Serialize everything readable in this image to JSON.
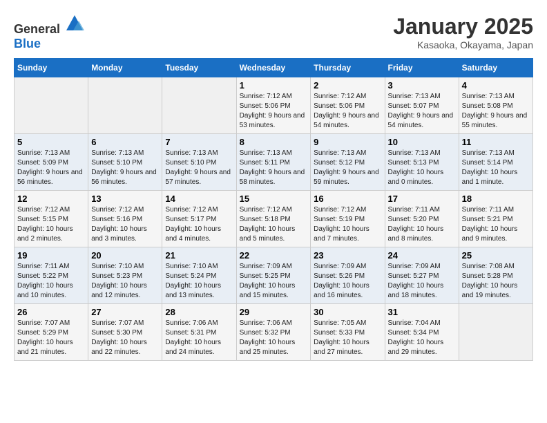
{
  "logo": {
    "general": "General",
    "blue": "Blue"
  },
  "title": "January 2025",
  "subtitle": "Kasaoka, Okayama, Japan",
  "days_of_week": [
    "Sunday",
    "Monday",
    "Tuesday",
    "Wednesday",
    "Thursday",
    "Friday",
    "Saturday"
  ],
  "weeks": [
    [
      {
        "day": "",
        "info": ""
      },
      {
        "day": "",
        "info": ""
      },
      {
        "day": "",
        "info": ""
      },
      {
        "day": "1",
        "info": "Sunrise: 7:12 AM\nSunset: 5:06 PM\nDaylight: 9 hours and 53 minutes."
      },
      {
        "day": "2",
        "info": "Sunrise: 7:12 AM\nSunset: 5:06 PM\nDaylight: 9 hours and 54 minutes."
      },
      {
        "day": "3",
        "info": "Sunrise: 7:13 AM\nSunset: 5:07 PM\nDaylight: 9 hours and 54 minutes."
      },
      {
        "day": "4",
        "info": "Sunrise: 7:13 AM\nSunset: 5:08 PM\nDaylight: 9 hours and 55 minutes."
      }
    ],
    [
      {
        "day": "5",
        "info": "Sunrise: 7:13 AM\nSunset: 5:09 PM\nDaylight: 9 hours and 56 minutes."
      },
      {
        "day": "6",
        "info": "Sunrise: 7:13 AM\nSunset: 5:10 PM\nDaylight: 9 hours and 56 minutes."
      },
      {
        "day": "7",
        "info": "Sunrise: 7:13 AM\nSunset: 5:10 PM\nDaylight: 9 hours and 57 minutes."
      },
      {
        "day": "8",
        "info": "Sunrise: 7:13 AM\nSunset: 5:11 PM\nDaylight: 9 hours and 58 minutes."
      },
      {
        "day": "9",
        "info": "Sunrise: 7:13 AM\nSunset: 5:12 PM\nDaylight: 9 hours and 59 minutes."
      },
      {
        "day": "10",
        "info": "Sunrise: 7:13 AM\nSunset: 5:13 PM\nDaylight: 10 hours and 0 minutes."
      },
      {
        "day": "11",
        "info": "Sunrise: 7:13 AM\nSunset: 5:14 PM\nDaylight: 10 hours and 1 minute."
      }
    ],
    [
      {
        "day": "12",
        "info": "Sunrise: 7:12 AM\nSunset: 5:15 PM\nDaylight: 10 hours and 2 minutes."
      },
      {
        "day": "13",
        "info": "Sunrise: 7:12 AM\nSunset: 5:16 PM\nDaylight: 10 hours and 3 minutes."
      },
      {
        "day": "14",
        "info": "Sunrise: 7:12 AM\nSunset: 5:17 PM\nDaylight: 10 hours and 4 minutes."
      },
      {
        "day": "15",
        "info": "Sunrise: 7:12 AM\nSunset: 5:18 PM\nDaylight: 10 hours and 5 minutes."
      },
      {
        "day": "16",
        "info": "Sunrise: 7:12 AM\nSunset: 5:19 PM\nDaylight: 10 hours and 7 minutes."
      },
      {
        "day": "17",
        "info": "Sunrise: 7:11 AM\nSunset: 5:20 PM\nDaylight: 10 hours and 8 minutes."
      },
      {
        "day": "18",
        "info": "Sunrise: 7:11 AM\nSunset: 5:21 PM\nDaylight: 10 hours and 9 minutes."
      }
    ],
    [
      {
        "day": "19",
        "info": "Sunrise: 7:11 AM\nSunset: 5:22 PM\nDaylight: 10 hours and 10 minutes."
      },
      {
        "day": "20",
        "info": "Sunrise: 7:10 AM\nSunset: 5:23 PM\nDaylight: 10 hours and 12 minutes."
      },
      {
        "day": "21",
        "info": "Sunrise: 7:10 AM\nSunset: 5:24 PM\nDaylight: 10 hours and 13 minutes."
      },
      {
        "day": "22",
        "info": "Sunrise: 7:09 AM\nSunset: 5:25 PM\nDaylight: 10 hours and 15 minutes."
      },
      {
        "day": "23",
        "info": "Sunrise: 7:09 AM\nSunset: 5:26 PM\nDaylight: 10 hours and 16 minutes."
      },
      {
        "day": "24",
        "info": "Sunrise: 7:09 AM\nSunset: 5:27 PM\nDaylight: 10 hours and 18 minutes."
      },
      {
        "day": "25",
        "info": "Sunrise: 7:08 AM\nSunset: 5:28 PM\nDaylight: 10 hours and 19 minutes."
      }
    ],
    [
      {
        "day": "26",
        "info": "Sunrise: 7:07 AM\nSunset: 5:29 PM\nDaylight: 10 hours and 21 minutes."
      },
      {
        "day": "27",
        "info": "Sunrise: 7:07 AM\nSunset: 5:30 PM\nDaylight: 10 hours and 22 minutes."
      },
      {
        "day": "28",
        "info": "Sunrise: 7:06 AM\nSunset: 5:31 PM\nDaylight: 10 hours and 24 minutes."
      },
      {
        "day": "29",
        "info": "Sunrise: 7:06 AM\nSunset: 5:32 PM\nDaylight: 10 hours and 25 minutes."
      },
      {
        "day": "30",
        "info": "Sunrise: 7:05 AM\nSunset: 5:33 PM\nDaylight: 10 hours and 27 minutes."
      },
      {
        "day": "31",
        "info": "Sunrise: 7:04 AM\nSunset: 5:34 PM\nDaylight: 10 hours and 29 minutes."
      },
      {
        "day": "",
        "info": ""
      }
    ]
  ]
}
